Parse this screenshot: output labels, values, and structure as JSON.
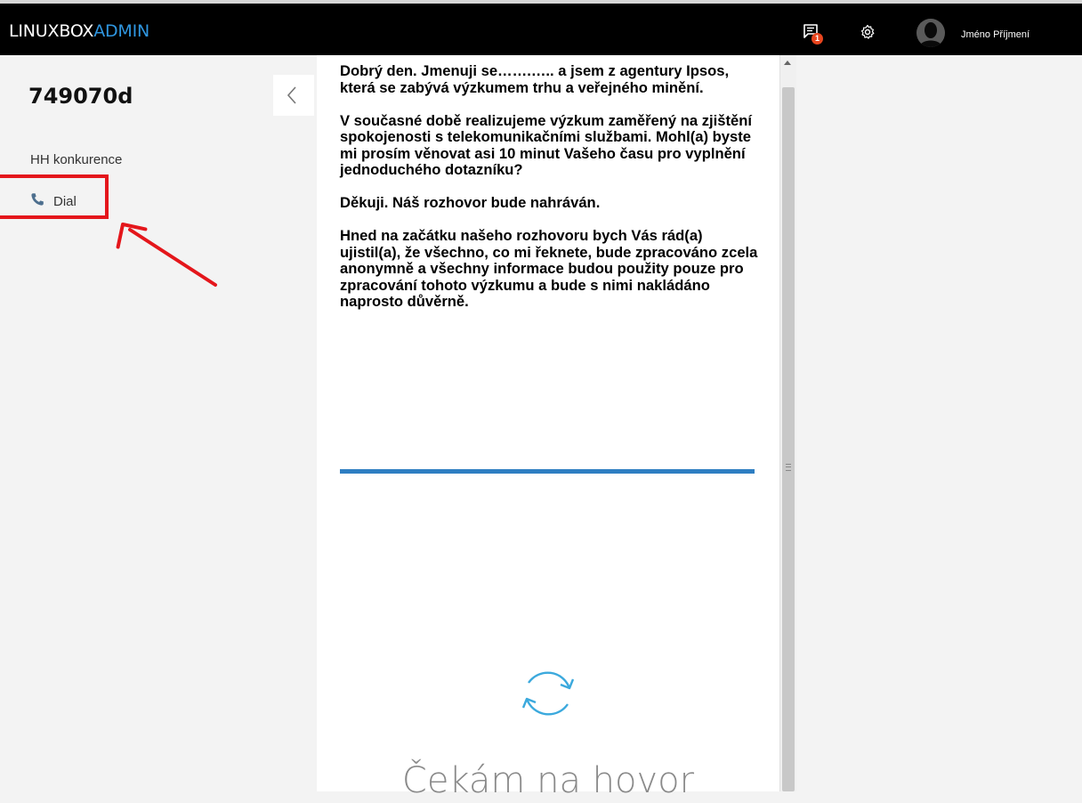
{
  "topbar": {
    "brand_part1": "LINUXBOX",
    "brand_part2": "ADMIN",
    "notification_count": "1",
    "user_name": "Jméno Příjmení"
  },
  "left": {
    "record_id": "749070d",
    "campaign": "HH konkurence",
    "dial_label": "Dial"
  },
  "script": {
    "paragraphs": [
      "Dobrý den. Jmenuji se…….….. a jsem z agentury Ipsos, která se zabývá výzkumem trhu a veřejného minění.",
      "V současné době realizujeme výzkum zaměřený na zjištění spokojenosti s telekomunikačními službami. Mohl(a) byste mi prosím věnovat asi 10 minut Vašeho času pro vyplnění jednoduchého dotazníku?",
      "Děkuji. Náš rozhovor bude nahráván.",
      "Hned na začátku našeho rozhovoru bych Vás rád(a) ujistil(a), že všechno, co mi řeknete, bude zpracováno zcela anonymně a všechny informace budou použity pouze pro zpracování tohoto výzkumu a bude s nimi nakládáno naprosto důvěrně."
    ],
    "waiting_text": "Čekám na hovor"
  },
  "colors": {
    "accent": "#2f96e0",
    "badge": "#e8451e",
    "highlight": "#e4161b",
    "divider": "#2e7ec2"
  },
  "icons": {
    "notifications": "chat-notification-icon",
    "settings": "gear-icon",
    "avatar": "user-avatar-icon",
    "phone": "phone-icon",
    "collapse": "chevron-left-icon",
    "refresh": "refresh-icon"
  }
}
